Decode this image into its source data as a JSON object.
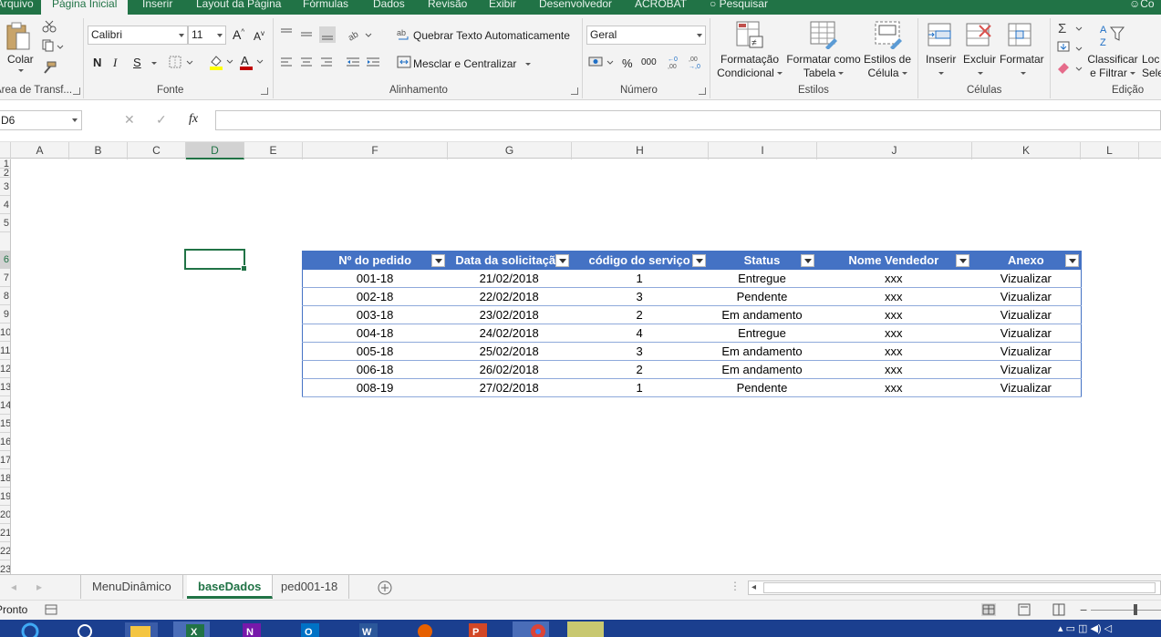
{
  "ribbon": {
    "tabs": [
      {
        "label": "Arquivo",
        "active": false
      },
      {
        "label": "Página Inicial",
        "active": true
      },
      {
        "label": "Inserir",
        "active": false
      },
      {
        "label": "Layout da Página",
        "active": false
      },
      {
        "label": "Fórmulas",
        "active": false
      },
      {
        "label": "Dados",
        "active": false
      },
      {
        "label": "Revisão",
        "active": false
      },
      {
        "label": "Exibir",
        "active": false
      },
      {
        "label": "Desenvolvedor",
        "active": false
      },
      {
        "label": "ACROBAT",
        "active": false
      }
    ],
    "search_label": "Pesquisar",
    "user_label": "Co",
    "clipboard": {
      "paste_label": "Colar",
      "group_label": "Área de Transf..."
    },
    "font": {
      "name": "Calibri",
      "size": "11",
      "bold": "N",
      "italic": "I",
      "underline": "S",
      "group_label": "Fonte"
    },
    "alignment": {
      "wrap_label": "Quebrar Texto Automaticamente",
      "merge_label": "Mesclar e Centralizar",
      "group_label": "Alinhamento"
    },
    "number": {
      "format": "Geral",
      "percent": "%",
      "thousands": "000",
      "group_label": "Número"
    },
    "styles": {
      "conditional_line1": "Formatação",
      "conditional_line2": "Condicional",
      "table_line1": "Formatar como",
      "table_line2": "Tabela",
      "cell_line1": "Estilos de",
      "cell_line2": "Célula",
      "group_label": "Estilos"
    },
    "cells": {
      "insert": "Inserir",
      "delete": "Excluir",
      "format": "Formatar",
      "group_label": "Células"
    },
    "editing": {
      "sort_line1": "Classificar",
      "sort_line2": "e Filtrar",
      "find_line1": "Loc",
      "find_line2": "Sele",
      "group_label": "Edição"
    }
  },
  "formula_bar": {
    "name_box": "D6",
    "fx": "fx",
    "value": ""
  },
  "columns": [
    "A",
    "B",
    "C",
    "D",
    "E",
    "F",
    "G",
    "H",
    "I",
    "J",
    "K",
    "L"
  ],
  "selected_column": "D",
  "rows": [
    "1",
    "2",
    "3",
    "4",
    "5",
    "6",
    "7",
    "8",
    "9",
    "10",
    "11",
    "12",
    "13",
    "14",
    "15",
    "16",
    "17",
    "18",
    "19",
    "20",
    "21",
    "22",
    "23"
  ],
  "selected_row": "6",
  "table": {
    "headers": [
      "Nº do pedido",
      "Data da solicitação",
      "código do serviço",
      "Status",
      "Nome Vendedor",
      "Anexo"
    ],
    "rows": [
      [
        "001-18",
        "21/02/2018",
        "1",
        "Entregue",
        "xxx",
        "Vizualizar"
      ],
      [
        "002-18",
        "22/02/2018",
        "3",
        "Pendente",
        "xxx",
        "Vizualizar"
      ],
      [
        "003-18",
        "23/02/2018",
        "2",
        "Em andamento",
        "xxx",
        "Vizualizar"
      ],
      [
        "004-18",
        "24/02/2018",
        "4",
        "Entregue",
        "xxx",
        "Vizualizar"
      ],
      [
        "005-18",
        "25/02/2018",
        "3",
        "Em andamento",
        "xxx",
        "Vizualizar"
      ],
      [
        "006-18",
        "26/02/2018",
        "2",
        "Em andamento",
        "xxx",
        "Vizualizar"
      ],
      [
        "008-19",
        "27/02/2018",
        "1",
        "Pendente",
        "xxx",
        "Vizualizar"
      ]
    ]
  },
  "sheets": [
    {
      "label": "MenuDinâmico",
      "active": false
    },
    {
      "label": "baseDados",
      "active": true
    },
    {
      "label": "ped001-18",
      "active": false
    }
  ],
  "status": {
    "ready": "Pronto"
  },
  "colors": {
    "excel_green": "#217346",
    "table_header": "#4472c4",
    "table_border": "#8ea9db",
    "taskbar": "#1b3f8f"
  }
}
